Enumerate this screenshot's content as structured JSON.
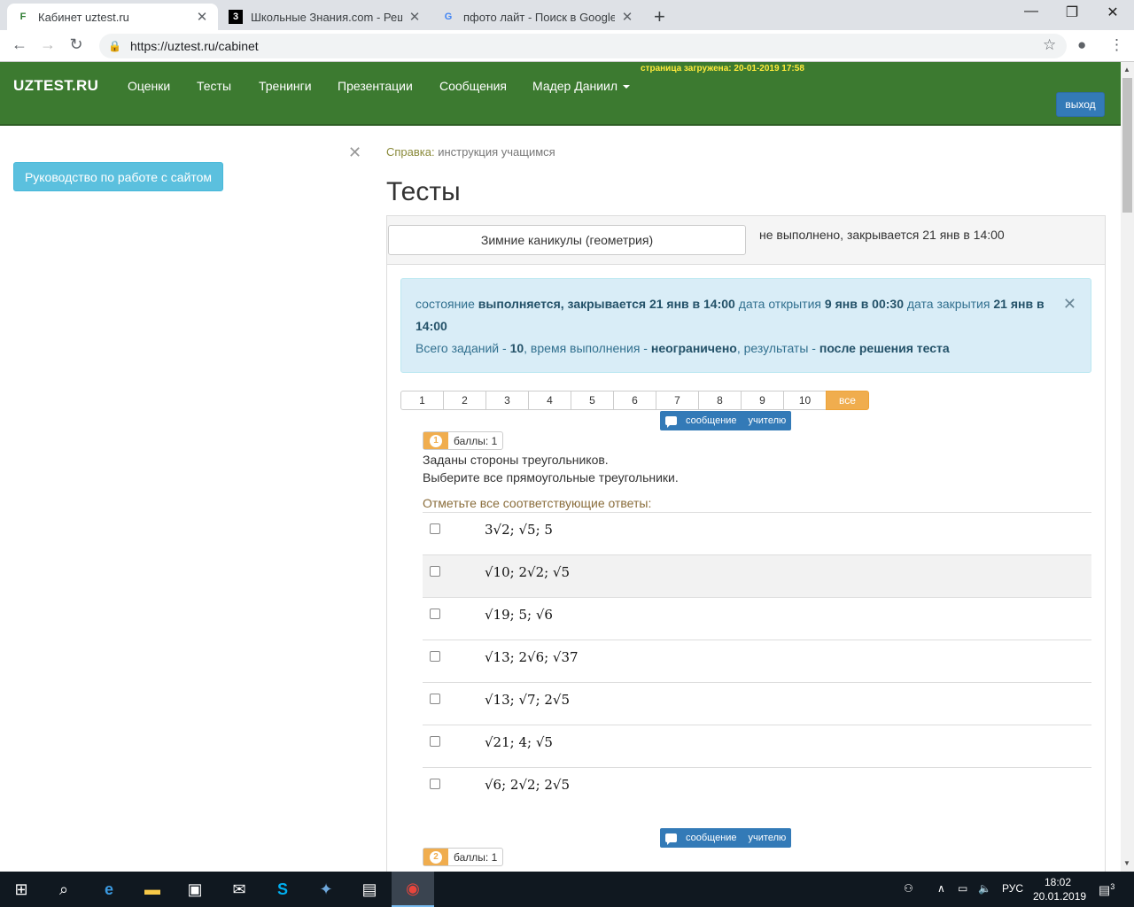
{
  "browser": {
    "tabs": [
      {
        "title": "Кабинет uztest.ru",
        "active": true
      },
      {
        "title": "Школьные Знания.com - Решае",
        "active": false
      },
      {
        "title": "пфото лайт - Поиск в Google",
        "active": false
      }
    ],
    "url": "https://uztest.ru/cabinet"
  },
  "header": {
    "brand": "UZTEST.RU",
    "menu": [
      "Оценки",
      "Тесты",
      "Тренинги",
      "Презентации",
      "Сообщения",
      "Мадер Даниил"
    ],
    "loaded": "страница загружена: 20-01-2019 17:58",
    "exit": "выход"
  },
  "sidebar": {
    "guide_button": "Руководство по работе с сайтом"
  },
  "main": {
    "help_label": "Справка:",
    "help_link": "инструкция учащимся",
    "title": "Тесты",
    "test_name": "Зимние каникулы (геометрия)",
    "test_status": "не выполнено, закрывается 21 янв в 14:00",
    "info": {
      "state_label": "состояние",
      "state_value": "выполняется, закрывается 21 янв в 14:00",
      "open_label": "дата открытия",
      "open_value": "9 янв в 00:30",
      "close_label": "дата закрытия",
      "close_value": "21 янв в 14:00",
      "total_label": "Всего заданий -",
      "total_value": "10",
      "time_label": ", время выполнения -",
      "time_value": "неограничено",
      "results_label": ", результаты -",
      "results_value": "после решения теста"
    },
    "pager": [
      "1",
      "2",
      "3",
      "4",
      "5",
      "6",
      "7",
      "8",
      "9",
      "10",
      "все"
    ],
    "message_button": {
      "word1": "сообщение",
      "word2": "учителю"
    },
    "question1": {
      "number": "1",
      "score": "баллы: 1",
      "line1": "Заданы стороны треугольников.",
      "line2": "Выберите все прямоугольные треугольники.",
      "hint": "Отметьте все соответствующие ответы:",
      "answers": [
        "3√2; √5; 5",
        "√10; 2√2; √5",
        "√19; 5; √6",
        "√13; 2√6; √37",
        "√13; √7; 2√5",
        "√21; 4; √5",
        "√6; 2√2; 2√5"
      ]
    },
    "question2": {
      "number": "2",
      "score": "баллы: 1"
    }
  },
  "taskbar": {
    "lang": "РУС",
    "time": "18:02",
    "date": "20.01.2019",
    "notifications": "3"
  }
}
